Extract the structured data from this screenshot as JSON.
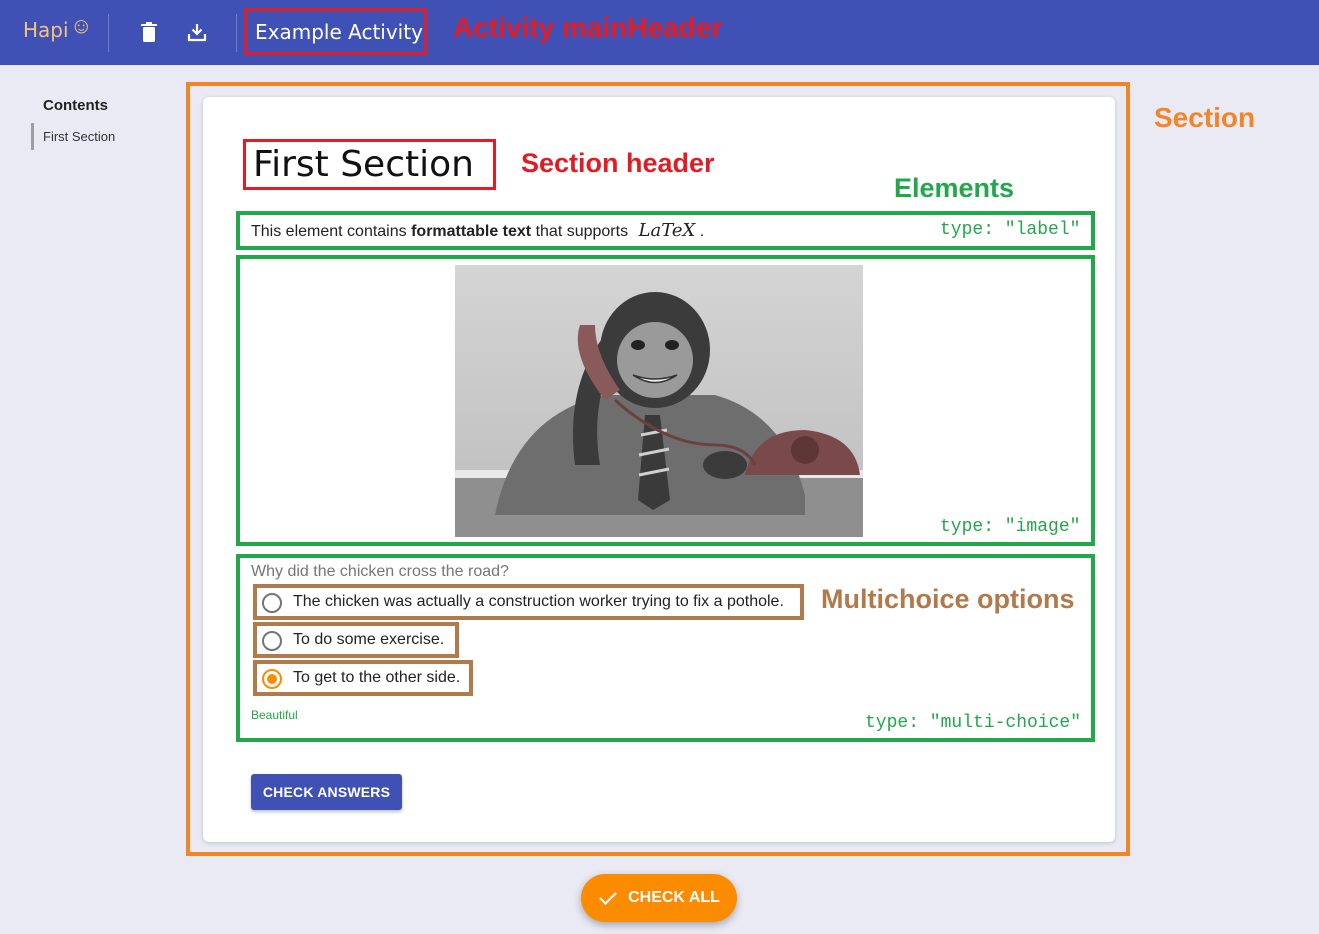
{
  "appbar": {
    "logo": "Hapi",
    "delete_icon": "trash-icon",
    "download_icon": "download-icon",
    "activity_title": "Example Activity"
  },
  "sidebar": {
    "title": "Contents",
    "items": [
      {
        "label": "First Section"
      }
    ]
  },
  "section": {
    "title": "First Section",
    "label_element": {
      "prefix": "This element contains",
      "bold": "formattable text",
      "suffix": "that supports",
      "latex": "LaTeX",
      "end": "."
    },
    "question": {
      "prompt": "Why did the chicken cross the road?",
      "options": [
        {
          "label": "The chicken was actually a construction worker trying to fix a pothole.",
          "selected": false
        },
        {
          "label": "To do some exercise.",
          "selected": false
        },
        {
          "label": "To get to the other side.",
          "selected": true
        }
      ],
      "feedback": "Beautiful"
    },
    "check_button": "CHECK ANSWERS"
  },
  "fab": {
    "label": "CHECK ALL"
  },
  "annotations": {
    "activity_main_header": "Activity mainHeader",
    "section": "Section",
    "section_header": "Section header",
    "elements": "Elements",
    "type_label": "type: \"label\"",
    "type_image": "type: \"image\"",
    "type_multi": "type: \"multi-choice\"",
    "multichoice_options": "Multichoice options"
  },
  "colors": {
    "primary": "#3f51b5",
    "accent": "#fb8c00",
    "annotation_red": "#e31b23",
    "annotation_orange": "#f58426",
    "annotation_green": "#22a84a",
    "annotation_brown": "#b07a4c"
  }
}
